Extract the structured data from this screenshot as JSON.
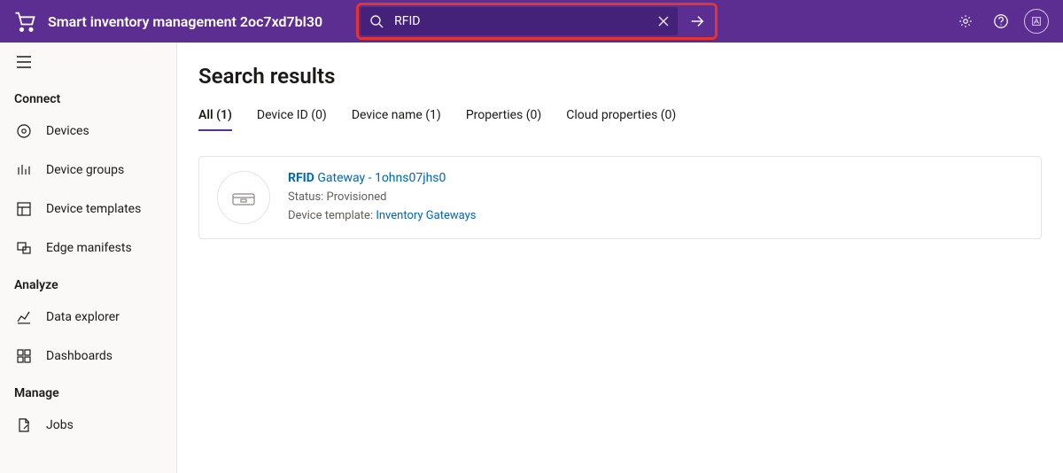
{
  "header": {
    "app_title": "Smart inventory management 2oc7xd7bl30",
    "search_value": "RFID",
    "avatar_initial": "A"
  },
  "sidebar": {
    "sections": [
      {
        "label": "Connect",
        "items": [
          {
            "icon": "devices",
            "label": "Devices"
          },
          {
            "icon": "device-groups",
            "label": "Device groups"
          },
          {
            "icon": "device-templates",
            "label": "Device templates"
          },
          {
            "icon": "edge-manifests",
            "label": "Edge manifests"
          }
        ]
      },
      {
        "label": "Analyze",
        "items": [
          {
            "icon": "data-explorer",
            "label": "Data explorer"
          },
          {
            "icon": "dashboards",
            "label": "Dashboards"
          }
        ]
      },
      {
        "label": "Manage",
        "items": [
          {
            "icon": "jobs",
            "label": "Jobs"
          }
        ]
      }
    ]
  },
  "main": {
    "title": "Search results",
    "tabs": [
      {
        "label": "All (1)",
        "active": true
      },
      {
        "label": "Device ID (0)",
        "active": false
      },
      {
        "label": "Device name (1)",
        "active": false
      },
      {
        "label": "Properties (0)",
        "active": false
      },
      {
        "label": "Cloud properties (0)",
        "active": false
      }
    ],
    "result": {
      "match": "RFID",
      "title_rest": " Gateway - 1ohns07jhs0",
      "status_label": "Status: ",
      "status_value": "Provisioned",
      "template_label": "Device template: ",
      "template_link": "Inventory Gateways"
    }
  }
}
